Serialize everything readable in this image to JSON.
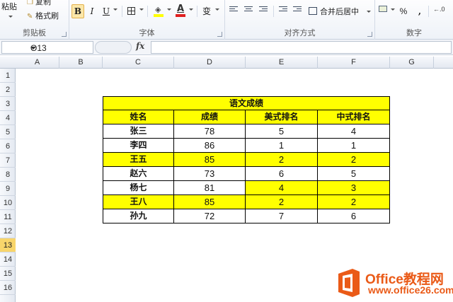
{
  "ribbon": {
    "clipboard": {
      "paste_label": "粘贴",
      "copy_label": "复制",
      "format_painter_label": "格式刷",
      "group_label": "剪贴板"
    },
    "font": {
      "bold": "B",
      "italic": "I",
      "underline": "U",
      "font_color_glyph": "A",
      "phonetic_glyph": "变",
      "group_label": "字体"
    },
    "alignment": {
      "merge_center_label": "合并后居中",
      "group_label": "对齐方式"
    },
    "number": {
      "percent": "%",
      "comma": ",",
      "group_label": "数字"
    }
  },
  "formula_bar": {
    "name_box": "O13",
    "fx_label": "fx",
    "formula": ""
  },
  "columns": [
    "A",
    "B",
    "C",
    "D",
    "E",
    "F",
    "G"
  ],
  "rows": [
    "1",
    "2",
    "3",
    "4",
    "5",
    "6",
    "7",
    "8",
    "9",
    "10",
    "11",
    "12",
    "13",
    "14",
    "15",
    "16"
  ],
  "active_row": "13",
  "table": {
    "title": "语文成绩",
    "headers": [
      "姓名",
      "成绩",
      "美式排名",
      "中式排名"
    ],
    "rows": [
      {
        "name": "张三",
        "score": "78",
        "us_rank": "5",
        "cn_rank": "4"
      },
      {
        "name": "李四",
        "score": "86",
        "us_rank": "1",
        "cn_rank": "1"
      },
      {
        "name": "王五",
        "score": "85",
        "us_rank": "2",
        "cn_rank": "2"
      },
      {
        "name": "赵六",
        "score": "73",
        "us_rank": "6",
        "cn_rank": "5"
      },
      {
        "name": "杨七",
        "score": "81",
        "us_rank": "4",
        "cn_rank": "3"
      },
      {
        "name": "王八",
        "score": "85",
        "us_rank": "2",
        "cn_rank": "2"
      },
      {
        "name": "孙九",
        "score": "72",
        "us_rank": "7",
        "cn_rank": "6"
      }
    ],
    "highlight_color": "#ffff00"
  },
  "watermark": {
    "brand": "Office教程网",
    "url": "www.office26.com"
  },
  "colors": {
    "accent_orange": "#ea5a17",
    "selected_row_header": "#f8d56b"
  }
}
